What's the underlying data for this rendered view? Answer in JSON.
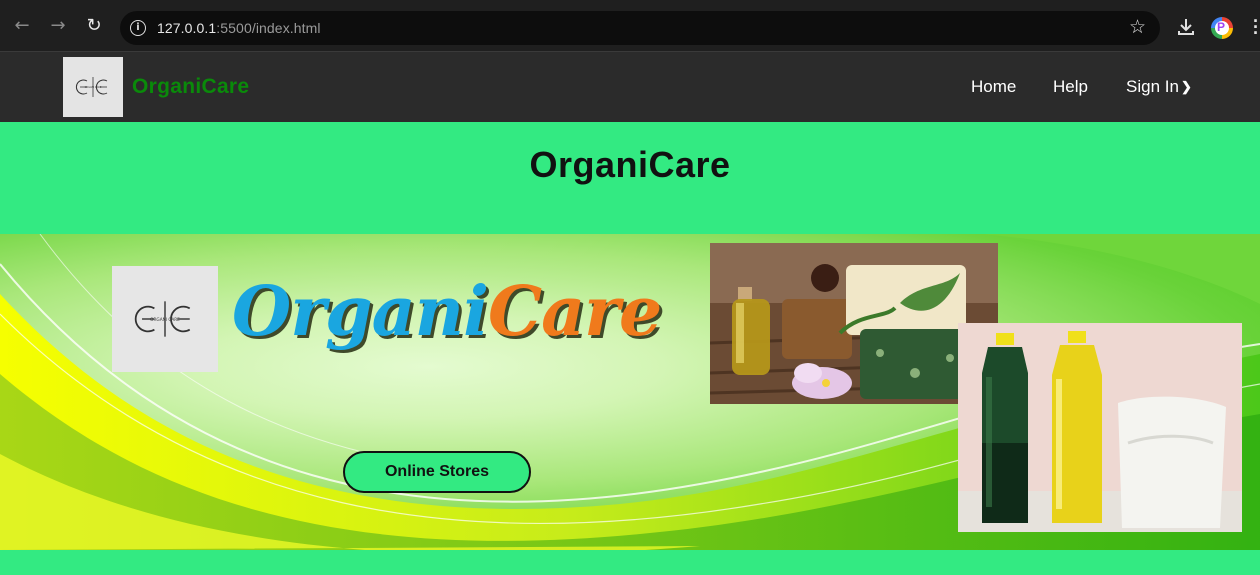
{
  "browser": {
    "url_host": "127.0.0.1",
    "url_rest": ":5500/index.html",
    "icons": [
      "back-icon",
      "forward-icon",
      "reload-icon",
      "site-info-icon",
      "bookmark-star-icon",
      "download-icon",
      "profile-icon",
      "menu-icon"
    ]
  },
  "nav": {
    "brand": "OrganiCare",
    "links": {
      "home": "Home",
      "help": "Help",
      "signin": "Sign In"
    },
    "logo_text": "ORGANI CARE"
  },
  "hero": {
    "title": "OrganiCare"
  },
  "banner": {
    "word_part1": "Organi",
    "word_part2": "Care",
    "button": "Online Stores",
    "colors": {
      "organi": "#1aa6e0",
      "care": "#f07a1c",
      "button_bg": "#33ea82"
    }
  },
  "colors": {
    "page_bg": "#33ea82",
    "navbar": "#2b2b2b",
    "brand": "#0a8a0a"
  }
}
